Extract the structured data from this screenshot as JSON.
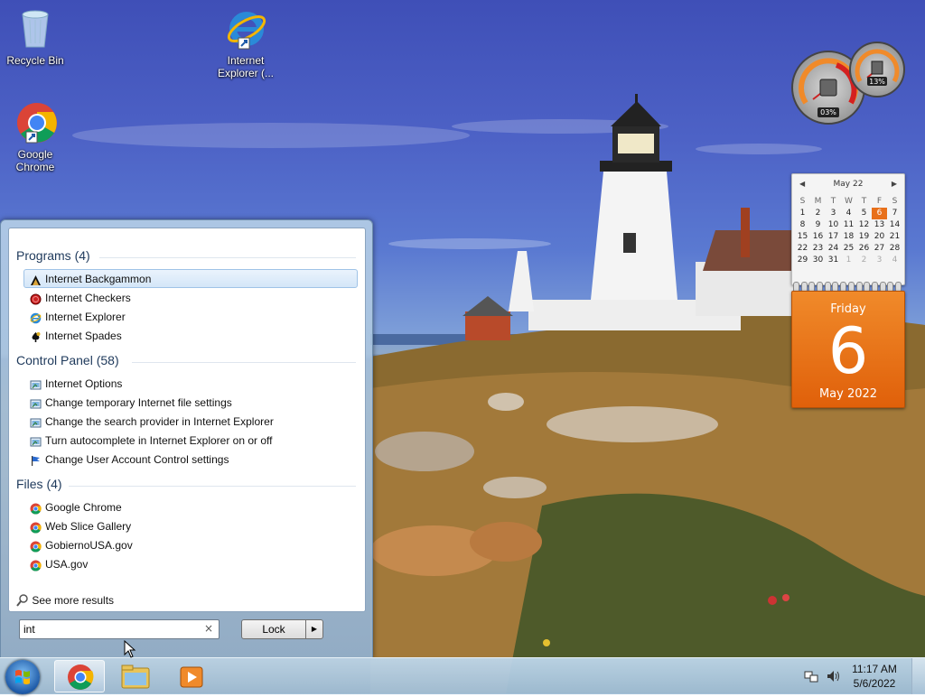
{
  "desktop": {
    "icons": [
      {
        "label": "Recycle Bin"
      },
      {
        "label": "Internet Explorer (..."
      },
      {
        "label": "Google Chrome"
      }
    ]
  },
  "gadgets": {
    "cpu_meter": {
      "cpu_percent": "03%",
      "memory_percent": "13%"
    },
    "calendar": {
      "month_header": "May 22",
      "weekday_headers": [
        "S",
        "M",
        "T",
        "W",
        "T",
        "F",
        "S"
      ],
      "days": [
        "1",
        "2",
        "3",
        "4",
        "5",
        "6",
        "7",
        "8",
        "9",
        "10",
        "11",
        "12",
        "13",
        "14",
        "15",
        "16",
        "17",
        "18",
        "19",
        "20",
        "21",
        "22",
        "23",
        "24",
        "25",
        "26",
        "27",
        "28",
        "29",
        "30",
        "31",
        "1",
        "2",
        "3",
        "4"
      ],
      "today": "6",
      "weekday": "Friday",
      "month_year": "May 2022"
    }
  },
  "start_menu": {
    "groups": [
      {
        "title": "Programs (4)",
        "items": [
          {
            "label": "Internet Backgammon",
            "icon": "backgammon-icon",
            "selected": true
          },
          {
            "label": "Internet Checkers",
            "icon": "checkers-icon"
          },
          {
            "label": "Internet Explorer",
            "icon": "internet-explorer-icon"
          },
          {
            "label": "Internet Spades",
            "icon": "spades-icon"
          }
        ]
      },
      {
        "title": "Control Panel (58)",
        "items": [
          {
            "label": "Internet Options",
            "icon": "control-panel-icon"
          },
          {
            "label": "Change temporary Internet file settings",
            "icon": "control-panel-icon"
          },
          {
            "label": "Change the search provider in Internet Explorer",
            "icon": "control-panel-icon"
          },
          {
            "label": "Turn autocomplete in Internet Explorer on or off",
            "icon": "control-panel-icon"
          },
          {
            "label": "Change User Account Control settings",
            "icon": "uac-flag-icon"
          }
        ]
      },
      {
        "title": "Files (4)",
        "items": [
          {
            "label": "Google Chrome",
            "icon": "chrome-icon"
          },
          {
            "label": "Web Slice Gallery",
            "icon": "chrome-icon"
          },
          {
            "label": "GobiernoUSA.gov",
            "icon": "chrome-icon"
          },
          {
            "label": "USA.gov",
            "icon": "chrome-icon"
          }
        ]
      }
    ],
    "see_more": "See more results",
    "search_value": "int",
    "clear_glyph": "×",
    "shutdown_label": "Lock",
    "shutdown_arrow": "▶"
  },
  "taskbar": {
    "pinned": [
      "chrome-icon",
      "explorer-folder-icon",
      "media-player-icon"
    ],
    "clock_time": "11:17 AM",
    "clock_date": "5/6/2022"
  },
  "colors": {
    "accent": "#e8701a",
    "selection": "#d4e6f8",
    "group_title": "#1e395b"
  }
}
